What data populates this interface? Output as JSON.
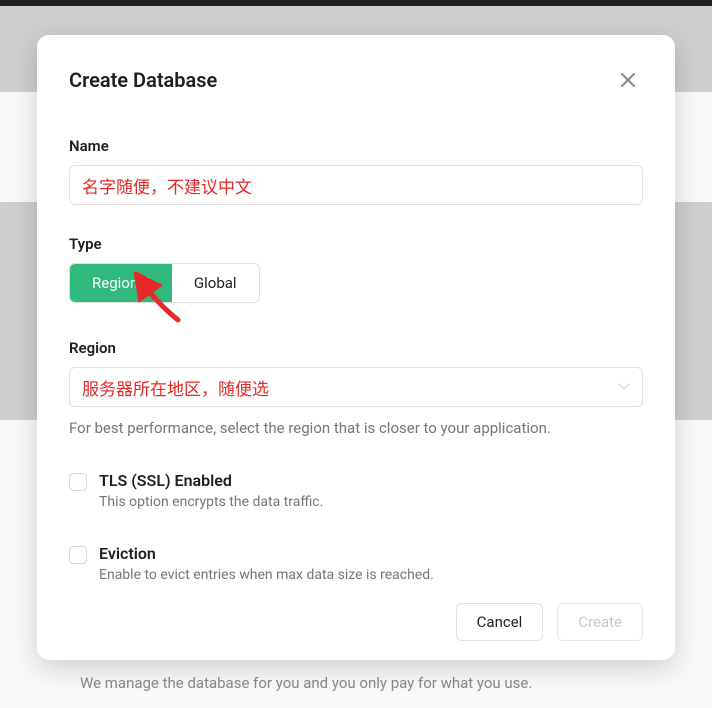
{
  "background_tagline": "We manage the database for you and you only pay for what you use.",
  "modal": {
    "title": "Create Database",
    "name": {
      "label": "Name",
      "value": "名字随便，不建议中文"
    },
    "type": {
      "label": "Type",
      "regional": "Regional",
      "global": "Global",
      "selected": "regional"
    },
    "region": {
      "label": "Region",
      "value": "服务器所在地区，随便选",
      "hint": "For best performance, select the region that is closer to your application."
    },
    "tls": {
      "title": "TLS (SSL) Enabled",
      "subtitle": "This option encrypts the data traffic."
    },
    "eviction": {
      "title": "Eviction",
      "subtitle": "Enable to evict entries when max data size is reached."
    },
    "buttons": {
      "cancel": "Cancel",
      "create": "Create"
    }
  },
  "colors": {
    "accent": "#2fb97c",
    "annotation": "#e62828"
  }
}
